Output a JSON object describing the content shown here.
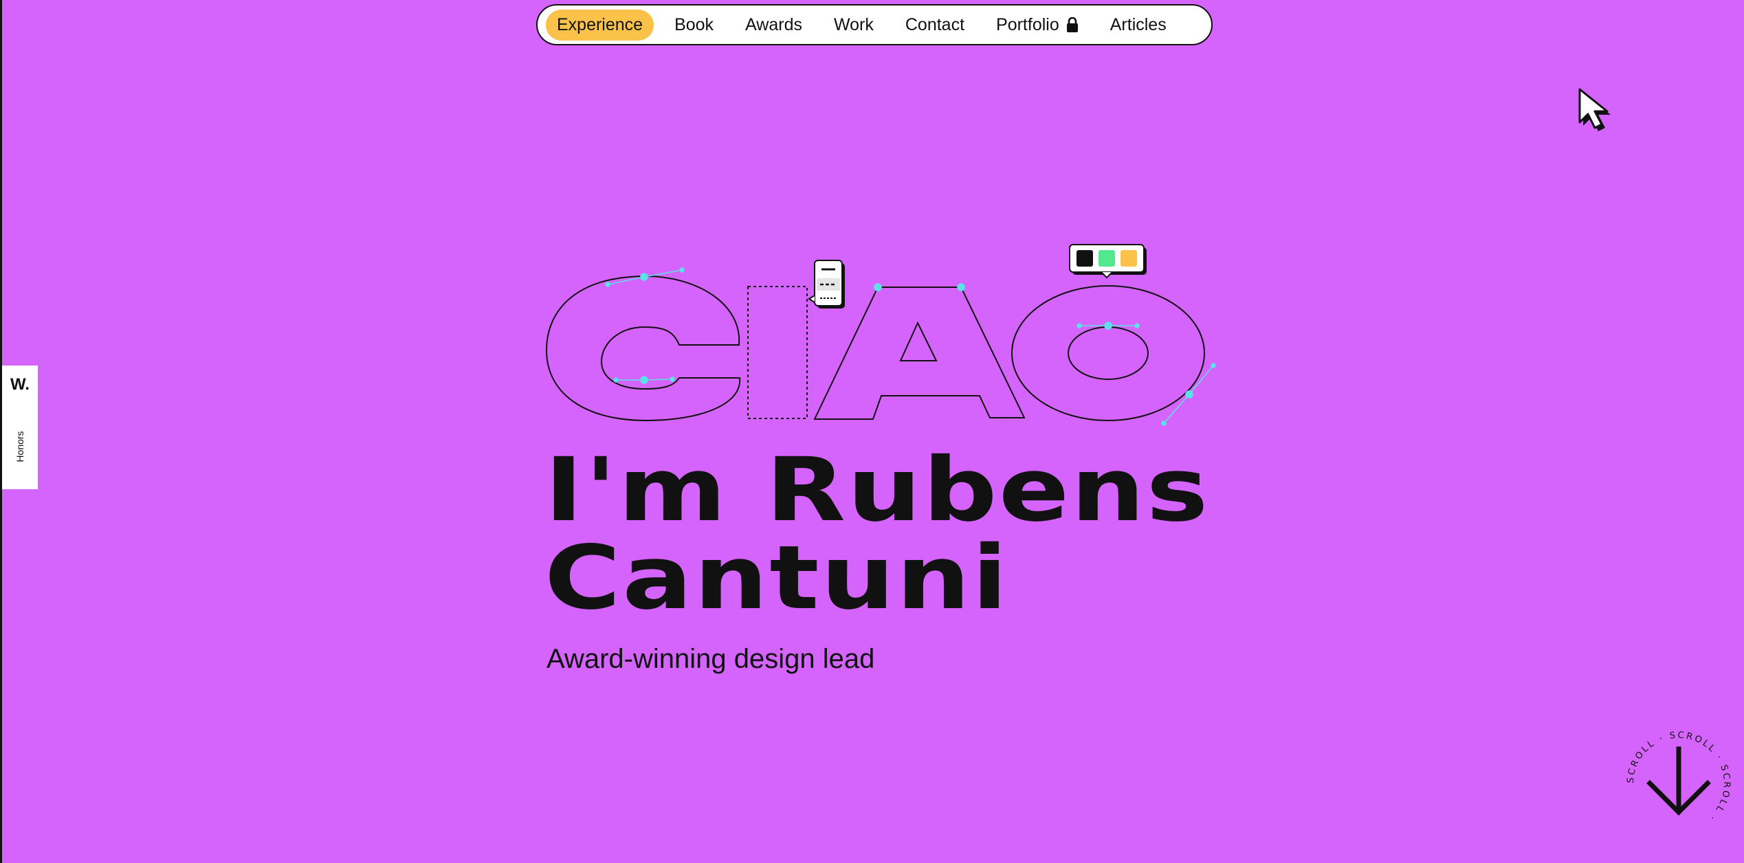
{
  "nav": {
    "items": [
      {
        "label": "Experience",
        "active": true
      },
      {
        "label": "Book",
        "active": false
      },
      {
        "label": "Awards",
        "active": false
      },
      {
        "label": "Work",
        "active": false
      },
      {
        "label": "Contact",
        "active": false
      },
      {
        "label": "Portfolio",
        "active": false,
        "icon": "lock-icon"
      },
      {
        "label": "Articles",
        "active": false
      }
    ]
  },
  "honors": {
    "logo": "W.",
    "label": "Honors"
  },
  "hero": {
    "greeting": "CIAO",
    "headline_line1": "I'm Rubens",
    "headline_line2": "Cantuni",
    "subtitle": "Award-winning design lead"
  },
  "scroll": {
    "label": "SCROLL · SCROLL · SCROLL · "
  },
  "colors": {
    "background": "#d464fb",
    "accent": "#fbc24a",
    "swatch_black": "#111111",
    "swatch_green": "#52e88d",
    "swatch_yellow": "#fbc24a",
    "handle": "#5ce1e6"
  }
}
